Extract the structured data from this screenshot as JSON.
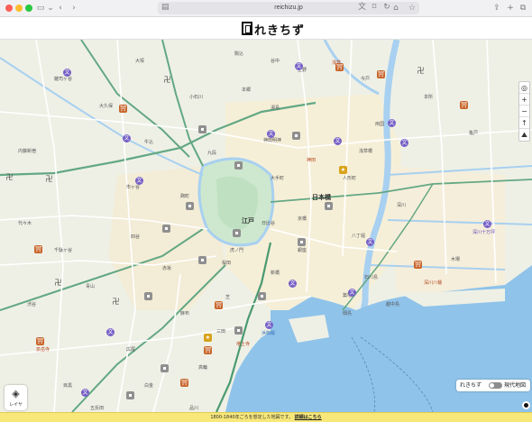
{
  "browser": {
    "url": "reichizu.jp",
    "traffic_colors": [
      "#ff5f57",
      "#febc2e",
      "#28c840"
    ]
  },
  "header": {
    "logo_text": "れきちず"
  },
  "map": {
    "labels": {
      "edo": "江戸",
      "nihonbashi": "日本橋",
      "kanda": "神田明神",
      "ueno_area": "上野",
      "hachobori": "八丁堀",
      "tsukiji": "築地",
      "fukagawa": "深川十万坪",
      "shiba": "芝",
      "shinagawa": "品川",
      "asakusa": "浅草",
      "ryogoku": "両国",
      "sakurada": "桜田",
      "hamagoten": "浜御殿",
      "ichigaya": "市ヶ谷",
      "yotsuya": "四谷",
      "akasaka": "赤坂",
      "azabu": "麻布",
      "honjo": "本所",
      "ushigome": "牛込",
      "koishikawa": "小石川",
      "hongo": "本郷",
      "yushima": "湯島",
      "sendagaya": "千駄ヶ谷",
      "aoyama": "青山",
      "meguro": "目黒",
      "takanawa": "高輪",
      "sumida": "隅田川",
      "kameido": "亀戸",
      "kiba": "木場",
      "fukagawa_hachiman": "深川八幡",
      "etchujima": "越中島",
      "ishikawajima": "石川島",
      "tsukudajima": "佃島",
      "shibaura": "芝浦",
      "zojoji": "増上寺",
      "sengakuji": "泉岳寺",
      "okubo": "大久保",
      "naito_shinjuku": "内藤新宿",
      "yoyogi": "代々木",
      "shibuya": "渋谷",
      "hiroo": "広尾",
      "mita": "三田",
      "shirokane": "白金",
      "gotanda": "五反田",
      "zoshigaya": "雑司ヶ谷",
      "otsuka": "大塚",
      "komagome": "駒込",
      "yanaka": "谷中",
      "negishi": "根岸",
      "minowa": "三ノ輪",
      "hashiba": "橋場",
      "mukojima": "向島",
      "oshiage": "押上",
      "kinshicho": "錦糸町",
      "sunamura": "砂村",
      "oshima": "大島",
      "fukagawa_toyo": "洲崎",
      "harumi": "海辺新田",
      "ikebukuro": "池袋",
      "takadanobaba": "高田馬場",
      "waseda": "早稲田",
      "mejiro": "目白",
      "ochanomizu": "御茶ノ水",
      "suidobashi": "水道橋",
      "kudan": "九段",
      "kanda_ward": "神田",
      "kyobashi": "京橋",
      "ginza": "銀座",
      "shinbashi": "新橋",
      "toranomon": "虎ノ門",
      "kasumigaseki": "霞ヶ関",
      "hibiya": "日比谷",
      "marunouchi": "大手町",
      "kojimachi": "麹町",
      "hanzomon": "半蔵門",
      "kioicho": "紀尾井町",
      "roppongi": "六本木",
      "iigura": "飯倉",
      "shibahama": "芝浜",
      "tamachi": "田町",
      "shinagawajuku": "品川宿",
      "minami_shinagawa": "南品川",
      "gyoranzaka": "行人坂",
      "hakusan": "白山",
      "sugamo": "巣鴨",
      "oji": "王子",
      "senju": "千住",
      "mukai": "向井",
      "imado": "今戸",
      "sanya": "山谷",
      "yoshiwara": "吉原",
      "kuramae": "蔵前",
      "asakusabashi": "浅草橋",
      "bakurocho": "馬喰町",
      "ningyocho": "人形町",
      "kayabacho": "茅場町",
      "reiganjima": "霊岸島",
      "teppozu": "鉄砲洲",
      "akashicho": "明石町",
      "tsukiji_honganji": "築地本願寺",
      "hamacho": "浜町",
      "fukagawa_ward": "深川",
      "monzen": "門前仲町",
      "senda": "千田",
      "ojima": "小名木川",
      "sarue": "猿江",
      "higashi": "東"
    }
  },
  "controls": {
    "locate": "◎",
    "zoom_in": "+",
    "zoom_out": "−",
    "north": "↑",
    "terrain": "⛰"
  },
  "layer_button": {
    "label": "レイヤ"
  },
  "toggle": {
    "left_label": "れきちず",
    "right_label": "現代地図"
  },
  "footer": {
    "text": "1800-1840年ごろを想定した地図です。",
    "link": "詳細はこちら"
  },
  "colors": {
    "land": "#eef0e6",
    "water": "#a8d0f0",
    "sea": "#8fc3ea",
    "road_major": "#ffffff",
    "road_highway": "#63a883",
    "road_tokaido": "#4b9a70",
    "urban_shade": "#f6efd8",
    "moat": "#a8d0f0",
    "castle_green": "#cde8cf",
    "footer_bg": "#f8e87a"
  }
}
